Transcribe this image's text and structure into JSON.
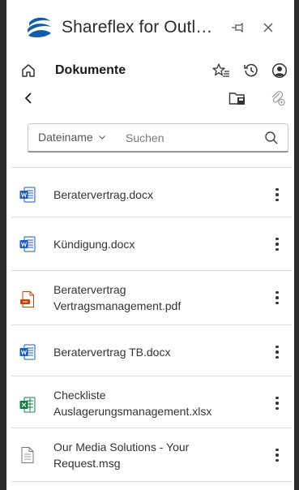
{
  "app": {
    "title": "Shareflex for Outl…"
  },
  "nav": {
    "title": "Dokumente"
  },
  "search": {
    "filter_label": "Dateiname",
    "placeholder": "Suchen",
    "value": ""
  },
  "files": [
    {
      "name_line1": "Beratervertrag.docx",
      "name_line2": "",
      "type": "word",
      "icon": "word-file-icon"
    },
    {
      "name_line1": "Kündigung.docx",
      "name_line2": "",
      "type": "word",
      "icon": "word-file-icon"
    },
    {
      "name_line1": "Beratervertrag",
      "name_line2": "Vertragsmanagement.pdf",
      "type": "pdf",
      "icon": "pdf-file-icon"
    },
    {
      "name_line1": "Beratervertrag TB.docx",
      "name_line2": "",
      "type": "word",
      "icon": "word-file-icon"
    },
    {
      "name_line1": "Checkliste",
      "name_line2": "Auslagerungsmanagement.xlsx",
      "type": "excel",
      "icon": "excel-file-icon"
    },
    {
      "name_line1": "Our Media Solutions - Your",
      "name_line2": "Request.msg",
      "type": "msg",
      "icon": "message-file-icon"
    }
  ],
  "colors": {
    "brand": "#0f5ea8",
    "word": "#185abd",
    "pdf": "#d83b01",
    "excel": "#107c41",
    "frame": "#2b2b2b"
  }
}
